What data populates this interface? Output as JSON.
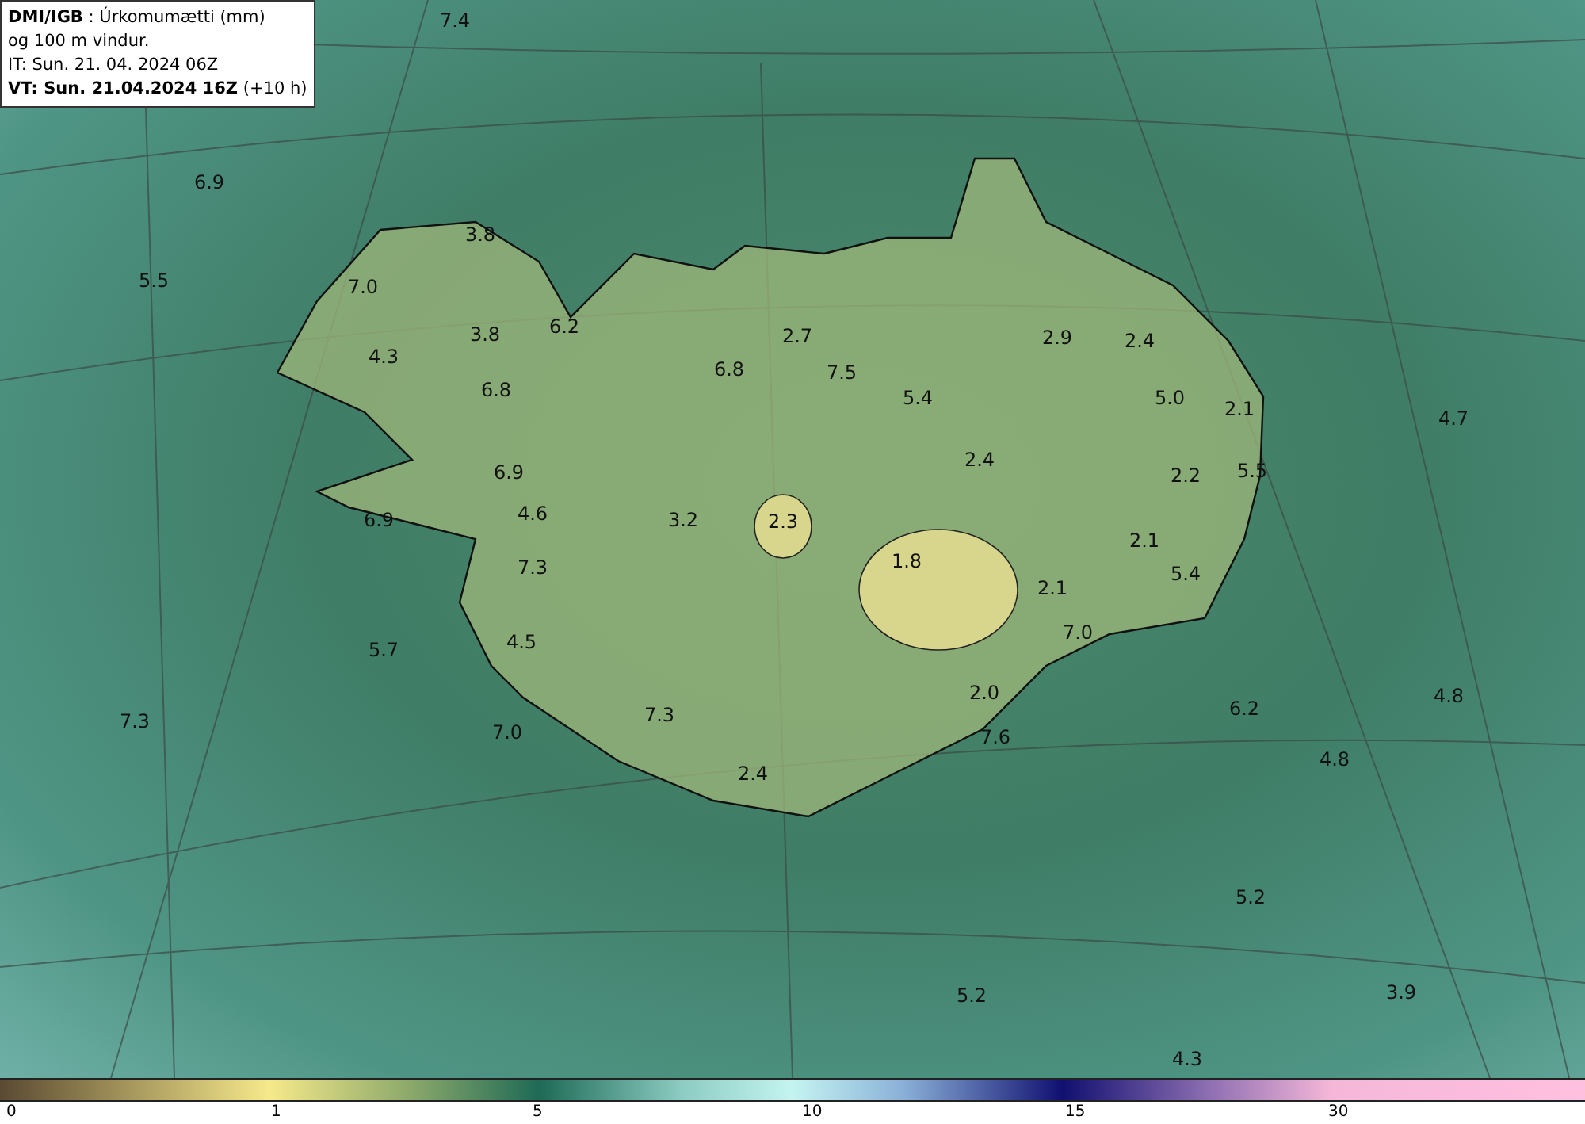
{
  "header": {
    "lines": [
      "**DMI/IGB** : Úrkomumætti (mm)",
      "og 100 m vindur.",
      "IT: Sun. 21. 04. 2024 06Z",
      "**VT: Sun. 21.04.2024 16Z** (+10 h)"
    ]
  },
  "map": {
    "values": [
      "7.4",
      "6.9",
      "3.8",
      "5.5",
      "7.0",
      "3.8",
      "6.2",
      "4.3",
      "6.8",
      "6.8",
      "2.7",
      "7.5",
      "5.4",
      "2.9",
      "2.4",
      "5.0",
      "2.1",
      "4.7",
      "2.4",
      "6.9",
      "2.2",
      "5.5",
      "6.9",
      "4.6",
      "3.2",
      "2.3",
      "2.1",
      "1.8",
      "7.3",
      "5.4",
      "2.1",
      "7.0",
      "4.5",
      "5.7",
      "4.8",
      "2.0",
      "6.2",
      "7.3",
      "7.3",
      "7.0",
      "7.6",
      "4.8",
      "2.4",
      "5.2",
      "5.2",
      "3.9",
      "4.3"
    ]
  },
  "legend": {
    "ticks": [
      "0",
      "1",
      "5",
      "10",
      "15",
      "30"
    ]
  }
}
